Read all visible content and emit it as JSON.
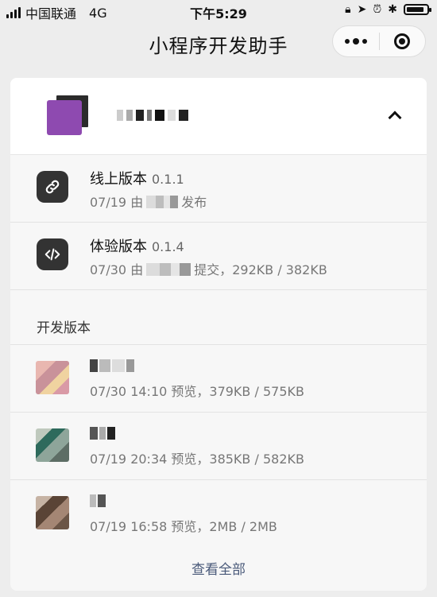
{
  "status_bar": {
    "carrier": "中国联通",
    "network": "4G",
    "time": "下午5:29"
  },
  "nav": {
    "title": "小程序开发助手"
  },
  "online_version": {
    "label": "线上版本",
    "version": "0.1.1",
    "date": "07/19",
    "by": "由",
    "action": "发布",
    "icon": "link-icon"
  },
  "trial_version": {
    "label": "体验版本",
    "version": "0.1.4",
    "date": "07/30",
    "by": "由",
    "action": "提交，292KB / 382KB",
    "icon": "code-icon"
  },
  "dev_section": {
    "title": "开发版本",
    "items": [
      {
        "meta": "07/30 14:10 预览，379KB / 575KB"
      },
      {
        "meta": "07/19 20:34 预览，385KB / 582KB"
      },
      {
        "meta": "07/19 16:58 预览，2MB / 2MB"
      }
    ],
    "view_all": "查看全部"
  }
}
